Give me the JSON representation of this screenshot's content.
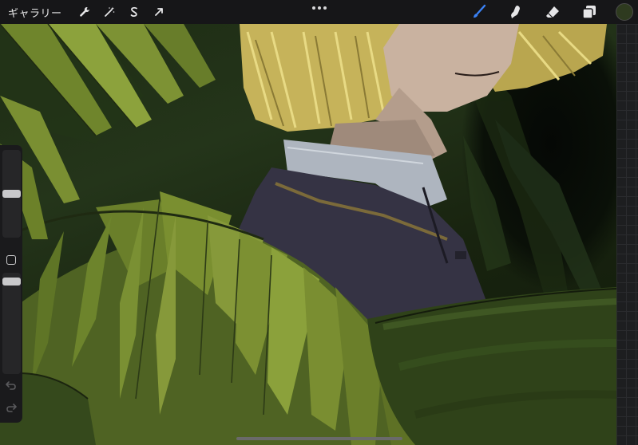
{
  "toolbar": {
    "gallery_label": "ギャラリー",
    "left_tools": [
      {
        "icon": "wrench-icon",
        "name": "actions"
      },
      {
        "icon": "magic-wand-icon",
        "name": "adjustments"
      },
      {
        "icon": "selection-s-icon",
        "name": "selection"
      },
      {
        "icon": "arrow-cursor-icon",
        "name": "transform"
      }
    ],
    "right_tools": [
      {
        "icon": "brush-icon",
        "name": "paint",
        "active": true
      },
      {
        "icon": "smudge-icon",
        "name": "smudge",
        "active": false
      },
      {
        "icon": "eraser-icon",
        "name": "erase",
        "active": false
      },
      {
        "icon": "layers-icon",
        "name": "layers",
        "active": false
      }
    ],
    "current_color": "#2e3a1f",
    "accent_color": "#3b82f6"
  },
  "sidebar": {
    "brush_size_value": 0.5,
    "brush_opacity_value": 0.95
  },
  "canvas": {
    "description_colors": {
      "leaf_light": "#7f9430",
      "leaf_mid": "#5f7425",
      "leaf_dark": "#2f4219",
      "background_dark": "#0c140a",
      "hair": "#d7c66a",
      "skin": "#c9b2a0",
      "coat": "#353344",
      "collar": "#aeb5bf"
    }
  }
}
